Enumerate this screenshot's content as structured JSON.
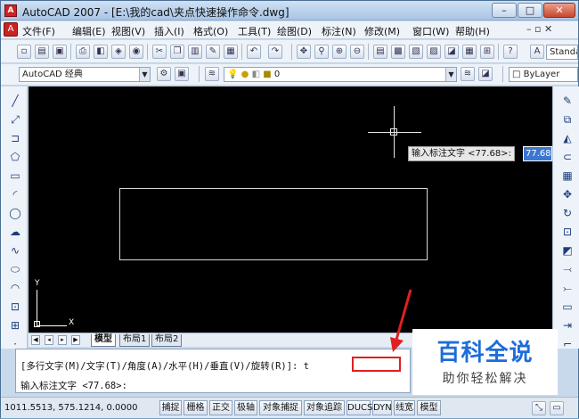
{
  "window": {
    "title": "AutoCAD 2007 - [E:\\我的cad\\夹点快速操作命令.dwg]",
    "app_icon": "A",
    "controls": {
      "minimize": "–",
      "maximize": "□",
      "close": "✕"
    }
  },
  "menubar": {
    "items": [
      "文件(F)",
      "编辑(E)",
      "视图(V)",
      "插入(I)",
      "格式(O)",
      "工具(T)",
      "绘图(D)",
      "标注(N)",
      "修改(M)",
      "窗口(W)",
      "帮助(H)"
    ],
    "mdi_controls": "– ▫ ✕"
  },
  "toolbar": {
    "standard_combo": "Standa",
    "workspace_combo": "AutoCAD 经典",
    "layer_combo": "0",
    "bylayer": "ByLayer"
  },
  "canvas": {
    "tooltip_label": "输入标注文字 <77.68>:",
    "tooltip_value": "77.68",
    "ucs_y": "Y",
    "ucs_x": "X"
  },
  "layout_tabs": [
    "模型",
    "布局1",
    "布局2"
  ],
  "command": {
    "line1": "[多行文字(M)/文字(T)/角度(A)/水平(H)/垂直(V)/旋转(R)]: t",
    "line2": "输入标注文字 <77.68>:"
  },
  "status": {
    "coords": "1011.5513, 575.1214, 0.0000",
    "buttons": [
      "捕捉",
      "栅格",
      "正交",
      "极轴",
      "对象捕捉",
      "对象追踪",
      "DUCS",
      "DYN",
      "线宽",
      "模型"
    ]
  },
  "watermark": {
    "title": "百科全说",
    "subtitle": "助你轻松解决"
  },
  "colors": {
    "canvas_bg": "#000000",
    "highlight": "#e02020",
    "watermark_blue": "#1e6dd8"
  }
}
